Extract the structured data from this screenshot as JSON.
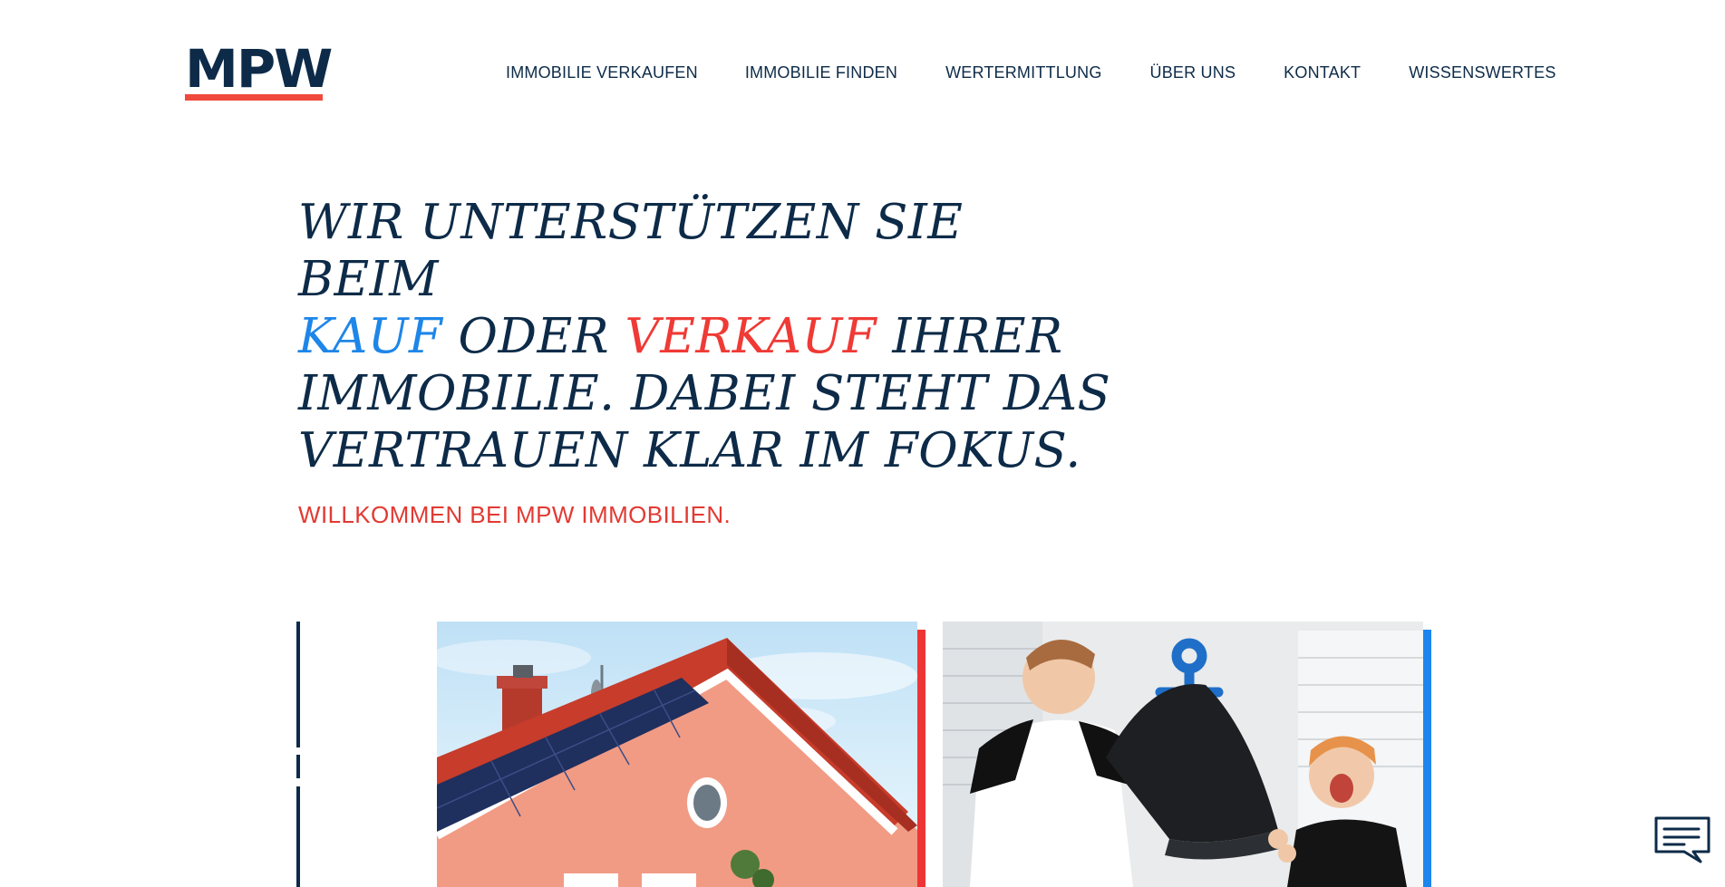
{
  "header": {
    "logo_text": "MPW",
    "nav": [
      {
        "label": "IMMOBILIE VERKAUFEN"
      },
      {
        "label": "IMMOBILIE FINDEN"
      },
      {
        "label": "WERTERMITTLUNG"
      },
      {
        "label": "ÜBER UNS"
      },
      {
        "label": "KONTAKT"
      },
      {
        "label": "WISSENSWERTES"
      }
    ]
  },
  "hero": {
    "heading_part1": "Wir unterstützen Sie beim",
    "heading_kauf": "Kauf",
    "heading_oder": "oder",
    "heading_verkauf": "Verkauf",
    "heading_part2": "Ihrer Immobilie. Dabei steht das Vertrauen klar im Fokus.",
    "subheading": "WILLKOMMEN BEI MPW IMMOBILIEN."
  },
  "cards": [
    {
      "image": "house-with-red-roof-and-solar-panels"
    },
    {
      "image": "children-pillow-fight"
    }
  ],
  "colors": {
    "navy": "#0d2b48",
    "red": "#ef3a35",
    "blue": "#1e86e8",
    "logo_underline": "#ef4a3c"
  },
  "chat": {
    "icon": "chat-bubble-icon"
  }
}
